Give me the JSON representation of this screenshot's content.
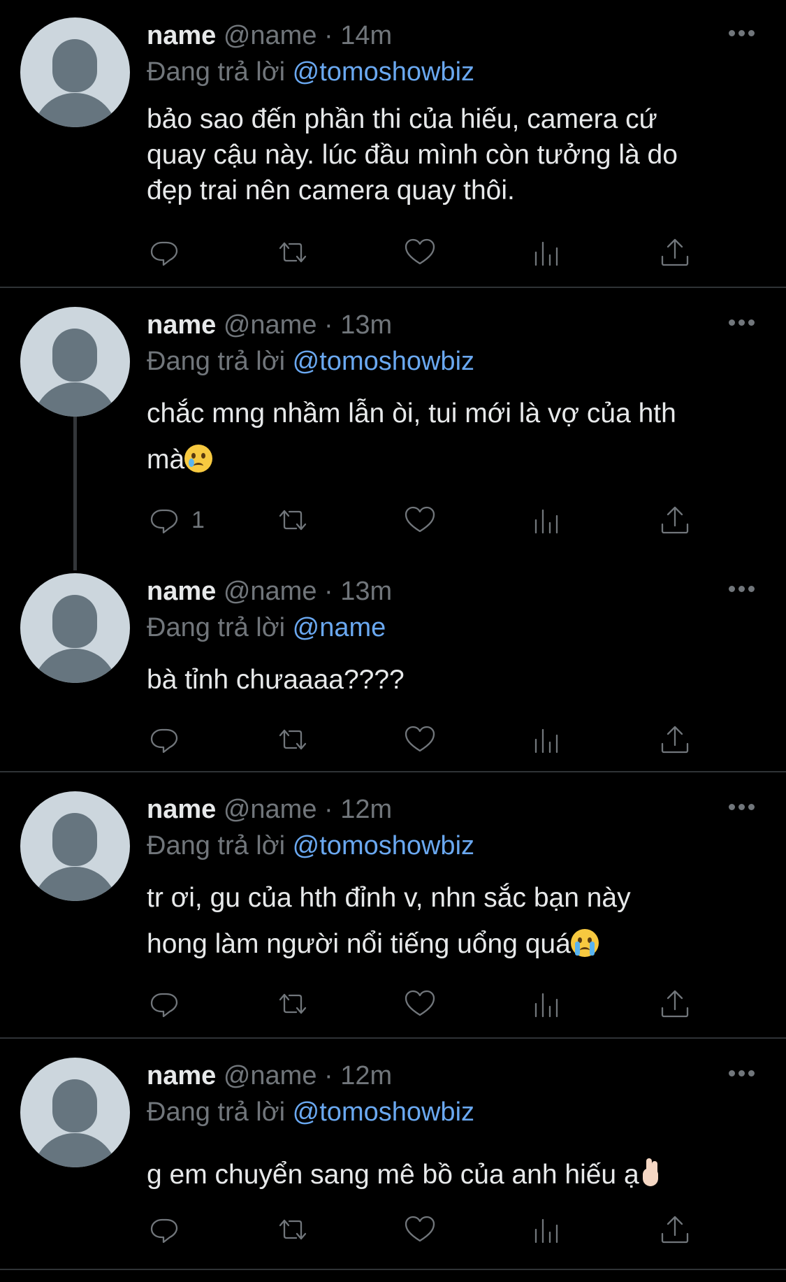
{
  "tweets": [
    {
      "name": "name",
      "handle": "@name",
      "time": "14m",
      "reply_prefix": "Đang trả lời",
      "reply_to": "@tomoshowbiz",
      "lines": [
        "bảo sao đến phần thi của hiếu, camera cứ",
        "quay cậu này. lúc đầu mình còn tưởng là do",
        "đẹp trai nên camera quay thôi."
      ],
      "emoji": "",
      "reply_count": ""
    },
    {
      "name": "name",
      "handle": "@name",
      "time": "13m",
      "reply_prefix": "Đang trả lời",
      "reply_to": "@tomoshowbiz",
      "lines": [
        "chắc mng nhầm lẫn òi, tui mới là vợ của hth",
        "mà"
      ],
      "emoji": "face-holding-back-tears",
      "reply_count": "1"
    },
    {
      "name": "name",
      "handle": "@name",
      "time": "13m",
      "reply_prefix": "Đang trả lời",
      "reply_to": "@name",
      "lines": [
        "bà tỉnh chưaaaa????"
      ],
      "emoji": "",
      "reply_count": ""
    },
    {
      "name": "name",
      "handle": "@name",
      "time": "12m",
      "reply_prefix": "Đang trả lời",
      "reply_to": "@tomoshowbiz",
      "lines": [
        "tr ơi, gu của hth đỉnh v, nhn sắc bạn này",
        "hong làm người nổi tiếng uổng quá"
      ],
      "emoji": "loudly-crying-face",
      "reply_count": ""
    },
    {
      "name": "name",
      "handle": "@name",
      "time": "12m",
      "reply_prefix": "Đang trả lời",
      "reply_to": "@tomoshowbiz",
      "lines": [
        "g em chuyển sang mê bồ của anh hiếu ạ"
      ],
      "emoji": "hand-with-index-and-middle-fingers-crossed",
      "reply_count": ""
    }
  ],
  "separator": "·",
  "icons": {
    "reply": "reply-icon",
    "retweet": "retweet-icon",
    "like": "heart-icon",
    "views": "analytics-icon",
    "share": "share-icon",
    "more": "more-icon"
  },
  "colors": {
    "background": "#000000",
    "text": "#e7e9ea",
    "secondary": "#71767b",
    "mention": "#6aa8f0",
    "divider": "#2f3336"
  }
}
